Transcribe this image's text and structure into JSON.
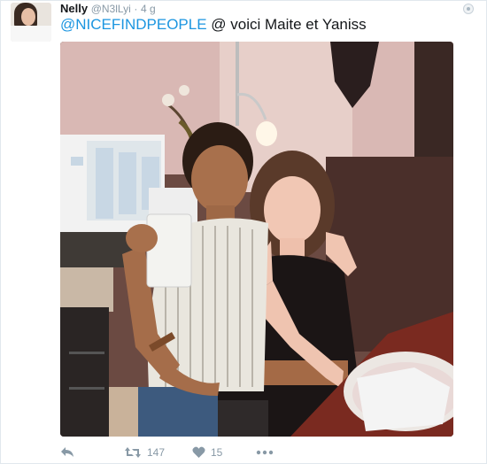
{
  "tweet": {
    "author_name": "Nelly",
    "author_handle": "@N3lLyi",
    "separator": "·",
    "time": "4 g",
    "hashtag": "@NICEFINDPEOPLE",
    "text": " @ voici Maite et Yaniss"
  },
  "actions": {
    "retweet_count": "147",
    "like_count": "15"
  },
  "colors": {
    "hashtag": "#1b95e0",
    "meta": "#8899a6",
    "like": "#8899a6"
  },
  "icons": {
    "reply": "reply-icon",
    "retweet": "retweet-icon",
    "like": "heart-icon",
    "more": "more-icon",
    "corner": "caret-icon"
  }
}
